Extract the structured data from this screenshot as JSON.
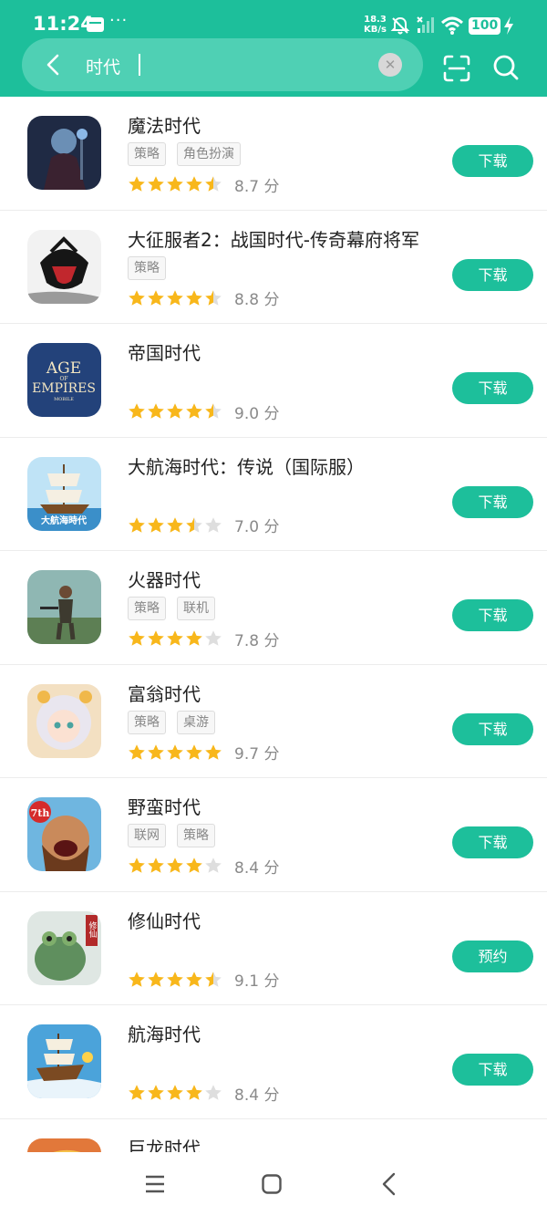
{
  "status_bar": {
    "time": "11:24",
    "dots": "···",
    "speed_value": "18.3",
    "speed_unit": "KB/s",
    "battery": "100"
  },
  "search": {
    "value": "时代"
  },
  "colors": {
    "accent": "#1dbf9b",
    "star": "#f8b71b",
    "star_empty": "#dedede"
  },
  "results": [
    {
      "name": "魔法时代",
      "tags": [
        "策略",
        "角色扮演"
      ],
      "rating": 4.5,
      "score": "8.7 分",
      "button": "下载",
      "icon": "wizard-app-icon"
    },
    {
      "name": "大征服者2：战国时代-传奇幕府将军",
      "tags": [
        "策略"
      ],
      "rating": 4.5,
      "score": "8.8 分",
      "button": "下载",
      "icon": "samurai-helmet-app-icon"
    },
    {
      "name": "帝国时代",
      "tags": [],
      "rating": 4.5,
      "score": "9.0 分",
      "button": "下载",
      "icon": "age-of-empires-app-icon",
      "icon_text": [
        "AGE",
        "OF",
        "EMPIRES",
        "MOBILE"
      ]
    },
    {
      "name": "大航海时代：传说（国际服）",
      "tags": [],
      "rating": 3.5,
      "score": "7.0 分",
      "button": "下载",
      "icon": "sailing-ship-app-icon",
      "icon_text": [
        "大航海時代"
      ]
    },
    {
      "name": "火器时代",
      "tags": [
        "策略",
        "联机"
      ],
      "rating": 4,
      "score": "7.8 分",
      "button": "下载",
      "icon": "soldier-app-icon"
    },
    {
      "name": "富翁时代",
      "tags": [
        "策略",
        "桌游"
      ],
      "rating": 5,
      "score": "9.7 分",
      "button": "下载",
      "icon": "anime-girl-app-icon"
    },
    {
      "name": "野蛮时代",
      "tags": [
        "联网",
        "策略"
      ],
      "rating": 4,
      "score": "8.4 分",
      "button": "下载",
      "icon": "barbarian-app-icon",
      "icon_text": [
        "7th"
      ]
    },
    {
      "name": "修仙时代",
      "tags": [],
      "rating": 4.5,
      "score": "9.1 分",
      "button": "预约",
      "icon": "toad-app-icon",
      "icon_text": [
        "修仙"
      ]
    },
    {
      "name": "航海时代",
      "tags": [],
      "rating": 4,
      "score": "8.4 分",
      "button": "下载",
      "icon": "pirate-ship-app-icon"
    },
    {
      "name": "巨龙时代",
      "tags": [],
      "rating": 0,
      "score": "",
      "button": "",
      "icon": "dragon-app-icon"
    }
  ]
}
